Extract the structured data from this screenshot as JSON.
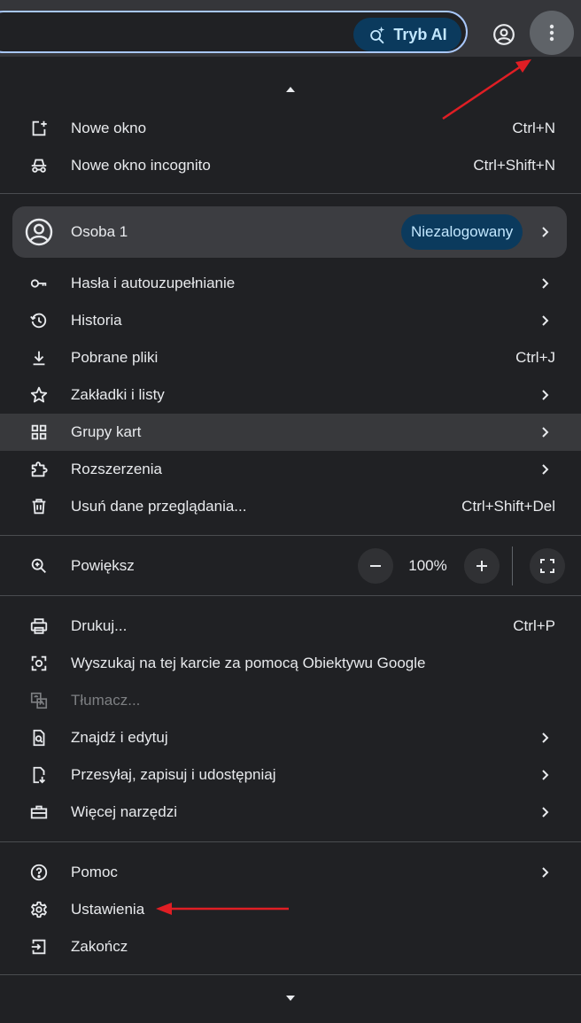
{
  "toolbar": {
    "ai_button_label": "Tryb AI",
    "ai_icon": "sparkle-search-icon",
    "profile_icon": "account-circle-icon",
    "menu_icon": "more-vert-icon"
  },
  "menu": {
    "new_window": {
      "label": "Nowe okno",
      "shortcut": "Ctrl+N",
      "icon": "new-window-icon"
    },
    "new_incognito": {
      "label": "Nowe okno incognito",
      "shortcut": "Ctrl+Shift+N",
      "icon": "incognito-icon"
    },
    "person": {
      "label": "Osoba 1",
      "badge": "Niezalogowany",
      "icon": "account-circle-icon"
    },
    "passwords": {
      "label": "Hasła i autouzupełnianie",
      "icon": "key-icon"
    },
    "history": {
      "label": "Historia",
      "icon": "history-icon"
    },
    "downloads": {
      "label": "Pobrane pliki",
      "shortcut": "Ctrl+J",
      "icon": "download-icon"
    },
    "bookmarks": {
      "label": "Zakładki i listy",
      "icon": "star-icon"
    },
    "tab_groups": {
      "label": "Grupy kart",
      "icon": "grid-icon"
    },
    "extensions": {
      "label": "Rozszerzenia",
      "icon": "puzzle-icon"
    },
    "clear_data": {
      "label": "Usuń dane przeglądania...",
      "shortcut": "Ctrl+Shift+Del",
      "icon": "trash-icon"
    },
    "zoom": {
      "label": "Powiększ",
      "value": "100%",
      "minus_icon": "minus-icon",
      "plus_icon": "plus-icon",
      "fullscreen_icon": "fullscreen-icon",
      "icon": "zoom-icon"
    },
    "print": {
      "label": "Drukuj...",
      "shortcut": "Ctrl+P",
      "icon": "printer-icon"
    },
    "lens": {
      "label": "Wyszukaj na tej karcie za pomocą Obiektywu Google",
      "icon": "lens-icon"
    },
    "translate": {
      "label": "Tłumacz...",
      "icon": "translate-icon"
    },
    "find_edit": {
      "label": "Znajdź i edytuj",
      "icon": "find-in-page-icon"
    },
    "cast_save_share": {
      "label": "Przesyłaj, zapisuj i udostępniaj",
      "icon": "file-share-icon"
    },
    "more_tools": {
      "label": "Więcej narzędzi",
      "icon": "toolbox-icon"
    },
    "help": {
      "label": "Pomoc",
      "icon": "help-icon"
    },
    "settings": {
      "label": "Ustawienia",
      "icon": "gear-icon"
    },
    "exit": {
      "label": "Zakończ",
      "icon": "exit-icon"
    }
  },
  "colors": {
    "menu_bg": "#202124",
    "highlight": "#38393c",
    "accent_badge_bg": "#0b3a5d",
    "accent_badge_text": "#c2e7ff",
    "annotation_arrow": "#e01e24"
  }
}
